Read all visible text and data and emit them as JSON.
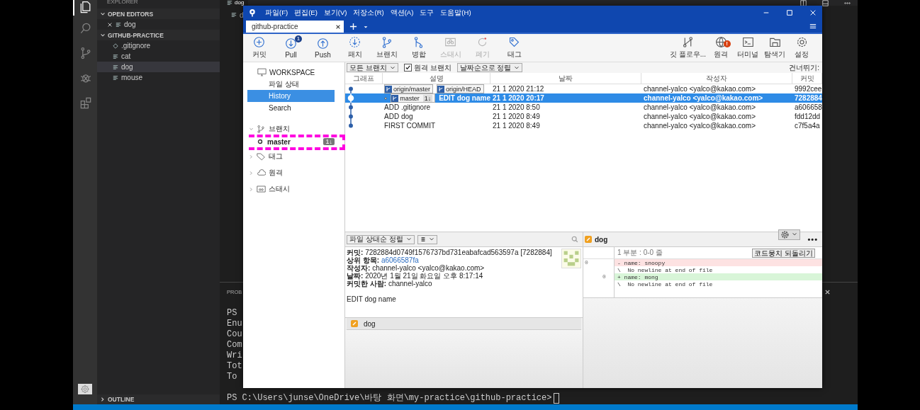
{
  "vscode": {
    "activity": [
      {
        "kind": "files",
        "selected": true
      },
      {
        "kind": "search",
        "selected": false
      },
      {
        "kind": "scm",
        "selected": false
      },
      {
        "kind": "debug",
        "selected": false
      },
      {
        "kind": "extensions",
        "selected": false
      }
    ],
    "sidebar_title": "EXPLORER",
    "open_editors": {
      "title": "OPEN EDITORS",
      "expanded": true,
      "items": [
        {
          "label": "dog"
        }
      ]
    },
    "folder": {
      "title": "GITHUB-PRACTICE",
      "expanded": true,
      "items": [
        {
          "label": ".gitignore",
          "kind": "ignore",
          "selected": false
        },
        {
          "label": "cat",
          "kind": "file",
          "selected": false
        },
        {
          "label": "dog",
          "kind": "file",
          "selected": true
        },
        {
          "label": "mouse",
          "kind": "file",
          "selected": false
        }
      ]
    },
    "outline": {
      "title": "OUTLINE",
      "expanded": false
    },
    "editor_tab": "dog",
    "breadcrumb": "d",
    "panel": {
      "tab": "PROB",
      "lines": [
        "PS",
        "Enu",
        "Cou",
        "Com",
        "Wri",
        "Tot",
        "To"
      ],
      "prompt": "PS C:\\Users\\junse\\OneDrive\\바탕 화면\\my-practice\\github-practice>"
    }
  },
  "sourcetree": {
    "menu": [
      "파일(F)",
      "편집(E)",
      "보기(V)",
      "저장소(R)",
      "액션(A)",
      "도구",
      "도움말(H)"
    ],
    "tabs": [
      {
        "label": "github-practice",
        "selected": true
      }
    ],
    "toolbar_left": [
      {
        "kind": "commit",
        "label": "커밋",
        "disabled": false
      },
      {
        "kind": "pull",
        "label": "Pull",
        "badge": "1",
        "disabled": false
      },
      {
        "kind": "push",
        "label": "Push",
        "disabled": false
      },
      {
        "kind": "fetch",
        "label": "패치",
        "disabled": false
      },
      {
        "kind": "branch",
        "label": "브랜치",
        "disabled": false
      },
      {
        "kind": "merge",
        "label": "병합",
        "disabled": false
      },
      {
        "kind": "stash",
        "label": "스태시",
        "disabled": true
      },
      {
        "kind": "discard",
        "label": "폐기",
        "disabled": true
      },
      {
        "kind": "tag",
        "label": "태그",
        "disabled": false
      }
    ],
    "toolbar_right": [
      {
        "kind": "gitflow",
        "label": "깃 플로우..."
      },
      {
        "kind": "remote",
        "label": "원격",
        "badge": "!"
      },
      {
        "kind": "terminal",
        "label": "터미널"
      },
      {
        "kind": "explorer",
        "label": "탐색기"
      },
      {
        "kind": "settings",
        "label": "설정"
      }
    ],
    "sidebar": {
      "workspace": "WORKSPACE",
      "items": [
        {
          "label": "파일 상태",
          "selected": false
        },
        {
          "label": "History",
          "selected": true
        },
        {
          "label": "Search",
          "selected": false
        }
      ],
      "groups": [
        {
          "kind": "branch",
          "label": "브랜치",
          "expanded": true,
          "children": [
            {
              "label": "master",
              "current": true,
              "badge": "1↓"
            }
          ]
        },
        {
          "kind": "tag",
          "label": "태그",
          "expanded": false
        },
        {
          "kind": "remote",
          "label": "원격",
          "expanded": false
        },
        {
          "kind": "stash",
          "label": "스태시",
          "expanded": false
        }
      ]
    },
    "filter": {
      "branches": "모든 브랜치",
      "remote_branches": {
        "label": "원격 브랜치",
        "checked": true
      },
      "sort": "날짜순으로 정렬",
      "jump": "건너뛰기:"
    },
    "columns": [
      "그래프",
      "설명",
      "날짜",
      "작성자",
      "커밋"
    ],
    "commits": [
      {
        "refs": [
          {
            "label": "origin/master"
          },
          {
            "label": "origin/HEAD"
          }
        ],
        "date": "21 1 2020 21:12",
        "author": "channel-yalco <yalco@kakao.com>",
        "hash": "9992cee",
        "selected": false,
        "head": false
      },
      {
        "refs": [
          {
            "label": "master",
            "badge": "1↓"
          }
        ],
        "message": "EDIT dog name",
        "date": "21 1 2020 20:17",
        "author": "channel-yalco <yalco@kakao.com>",
        "hash": "7282884",
        "selected": true,
        "head": true
      },
      {
        "message": "ADD .gitignore",
        "date": "21 1 2020 8:50",
        "author": "channel-yalco <yalco@kakao.com>",
        "hash": "a606658",
        "selected": false,
        "head": false
      },
      {
        "message": "ADD dog",
        "date": "21 1 2020 8:49",
        "author": "channel-yalco <yalco@kakao.com>",
        "hash": "fdd12dd",
        "selected": false,
        "head": false
      },
      {
        "message": "FIRST COMMIT",
        "date": "21 1 2020 8:49",
        "author": "channel-yalco <yalco@kakao.com>",
        "hash": "c7f5a4a",
        "selected": false,
        "head": false
      }
    ],
    "details": {
      "sort": "파일 상태순 정렬",
      "fields": [
        {
          "label": "커밋:",
          "value": "7282884d0749f1576737bd731eabafcad563597a [7282884]",
          "kind": "text"
        },
        {
          "label": "상위 항목:",
          "value": "a6066587fa",
          "kind": "link"
        },
        {
          "label": "작성자:",
          "value": "channel-yalco <yalco@kakao.com>",
          "kind": "text"
        },
        {
          "label": "날짜:",
          "value": "2020년 1월 21일 화요일 오후 8:17:14",
          "kind": "text"
        },
        {
          "label": "커밋한 사람:",
          "value": "channel-yalco",
          "kind": "text"
        }
      ],
      "message": "EDIT dog name",
      "files": [
        {
          "name": "dog",
          "selected": false
        }
      ]
    },
    "diff": {
      "file": "dog",
      "more": "•••",
      "hunk": "1 부분 : 0-0 줄",
      "revert": "코드뭉치 되돌리기",
      "lines": [
        {
          "kind": "removed",
          "old": "0",
          "text": "- name: snoopy"
        },
        {
          "kind": "context",
          "text": "\\  No newline at end of file"
        },
        {
          "kind": "added",
          "new": "0",
          "text": "+ name: mong"
        },
        {
          "kind": "context",
          "text": "\\  No newline at end of file"
        }
      ]
    }
  }
}
